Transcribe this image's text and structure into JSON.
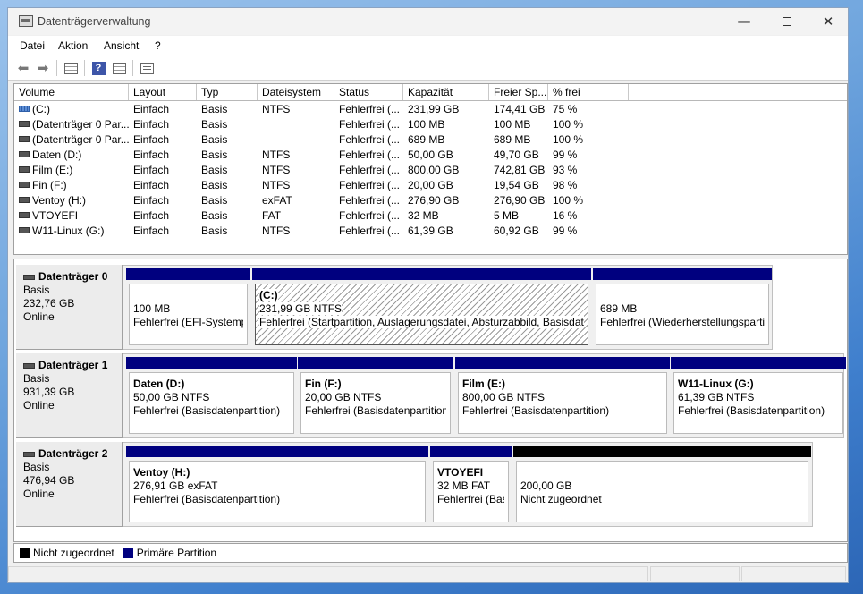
{
  "window": {
    "title": "Datenträgerverwaltung"
  },
  "menu": [
    "Datei",
    "Aktion",
    "Ansicht",
    "?"
  ],
  "toolbar": {
    "back_icon": "arrow-left-icon",
    "forward_icon": "arrow-right-icon",
    "help_label": "?"
  },
  "volume_list": {
    "columns": [
      "Volume",
      "Layout",
      "Typ",
      "Dateisystem",
      "Status",
      "Kapazität",
      "Freier Sp...",
      "% frei"
    ],
    "rows": [
      {
        "volume": "(C:)",
        "layout": "Einfach",
        "typ": "Basis",
        "fs": "NTFS",
        "status": "Fehlerfrei (...",
        "cap": "231,99 GB",
        "free": "174,41 GB",
        "pct": "75 %"
      },
      {
        "volume": "(Datenträger 0 Par...",
        "layout": "Einfach",
        "typ": "Basis",
        "fs": "",
        "status": "Fehlerfrei (...",
        "cap": "100 MB",
        "free": "100 MB",
        "pct": "100 %"
      },
      {
        "volume": "(Datenträger 0 Par...",
        "layout": "Einfach",
        "typ": "Basis",
        "fs": "",
        "status": "Fehlerfrei (...",
        "cap": "689 MB",
        "free": "689 MB",
        "pct": "100 %"
      },
      {
        "volume": "Daten (D:)",
        "layout": "Einfach",
        "typ": "Basis",
        "fs": "NTFS",
        "status": "Fehlerfrei (...",
        "cap": "50,00 GB",
        "free": "49,70 GB",
        "pct": "99 %"
      },
      {
        "volume": "Film (E:)",
        "layout": "Einfach",
        "typ": "Basis",
        "fs": "NTFS",
        "status": "Fehlerfrei (...",
        "cap": "800,00 GB",
        "free": "742,81 GB",
        "pct": "93 %"
      },
      {
        "volume": "Fin (F:)",
        "layout": "Einfach",
        "typ": "Basis",
        "fs": "NTFS",
        "status": "Fehlerfrei (...",
        "cap": "20,00 GB",
        "free": "19,54 GB",
        "pct": "98 %"
      },
      {
        "volume": "Ventoy (H:)",
        "layout": "Einfach",
        "typ": "Basis",
        "fs": "exFAT",
        "status": "Fehlerfrei (...",
        "cap": "276,90 GB",
        "free": "276,90 GB",
        "pct": "100 %"
      },
      {
        "volume": "VTOYEFI",
        "layout": "Einfach",
        "typ": "Basis",
        "fs": "FAT",
        "status": "Fehlerfrei (...",
        "cap": "32 MB",
        "free": "5 MB",
        "pct": "16 %"
      },
      {
        "volume": "W11-Linux (G:)",
        "layout": "Einfach",
        "typ": "Basis",
        "fs": "NTFS",
        "status": "Fehlerfrei (...",
        "cap": "61,39 GB",
        "free": "60,92 GB",
        "pct": "99 %"
      }
    ]
  },
  "disks": [
    {
      "name": "Datenträger 0",
      "type": "Basis",
      "size": "232,76 GB",
      "state": "Online",
      "partitions": [
        {
          "name": "",
          "size": "100 MB",
          "status": "Fehlerfrei (EFI-Systempartition)",
          "kind": "primary",
          "selected": false
        },
        {
          "name": "(C:)",
          "size": "231,99 GB NTFS",
          "status": "Fehlerfrei (Startpartition, Auslagerungsdatei, Absturzabbild, Basisdatenpartition)",
          "kind": "primary",
          "selected": true
        },
        {
          "name": "",
          "size": "689 MB",
          "status": "Fehlerfrei (Wiederherstellungspartition)",
          "kind": "primary",
          "selected": false
        }
      ]
    },
    {
      "name": "Datenträger 1",
      "type": "Basis",
      "size": "931,39 GB",
      "state": "Online",
      "partitions": [
        {
          "name": "Daten  (D:)",
          "size": "50,00 GB NTFS",
          "status": "Fehlerfrei (Basisdatenpartition)",
          "kind": "primary",
          "selected": false
        },
        {
          "name": "Fin  (F:)",
          "size": "20,00 GB NTFS",
          "status": "Fehlerfrei (Basisdatenpartition)",
          "kind": "primary",
          "selected": false
        },
        {
          "name": "Film  (E:)",
          "size": "800,00 GB NTFS",
          "status": "Fehlerfrei (Basisdatenpartition)",
          "kind": "primary",
          "selected": false
        },
        {
          "name": "W11-Linux  (G:)",
          "size": "61,39 GB NTFS",
          "status": "Fehlerfrei (Basisdatenpartition)",
          "kind": "primary",
          "selected": false
        }
      ]
    },
    {
      "name": "Datenträger 2",
      "type": "Basis",
      "size": "476,94 GB",
      "state": "Online",
      "partitions": [
        {
          "name": "Ventoy  (H:)",
          "size": "276,91 GB exFAT",
          "status": "Fehlerfrei (Basisdatenpartition)",
          "kind": "primary",
          "selected": false
        },
        {
          "name": "VTOYEFI",
          "size": "32 MB FAT",
          "status": "Fehlerfrei (Basisdatenpartition)",
          "kind": "primary",
          "selected": false
        },
        {
          "name": "",
          "size": "200,00 GB",
          "status": "Nicht zugeordnet",
          "kind": "unallocated",
          "selected": false
        }
      ]
    }
  ],
  "legend": [
    {
      "label": "Nicht zugeordnet",
      "color": "#000000"
    },
    {
      "label": "Primäre Partition",
      "color": "#00007f"
    }
  ]
}
